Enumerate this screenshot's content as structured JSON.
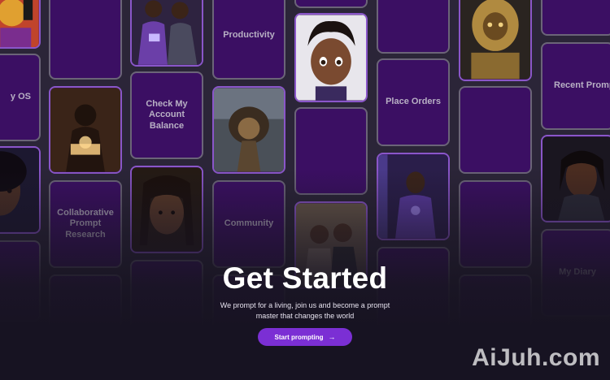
{
  "tiles": {
    "my_os": "y OS",
    "check_balance": "Check My Account Balance",
    "productivity": "Productivity",
    "place_orders": "Place Orders",
    "recent_prompts": "Recent Promp",
    "collab_research": "Collaborative Prompt Research",
    "community": "Community",
    "my_diary": "My Diary"
  },
  "hero": {
    "title": "Get Started",
    "subtitle": "We prompt for a living, join us and become a prompt master that changes the world",
    "cta_label": "Start prompting"
  },
  "watermark": "AiJuh.com",
  "icons": {
    "cta_arrow": "arrow-right-icon"
  }
}
